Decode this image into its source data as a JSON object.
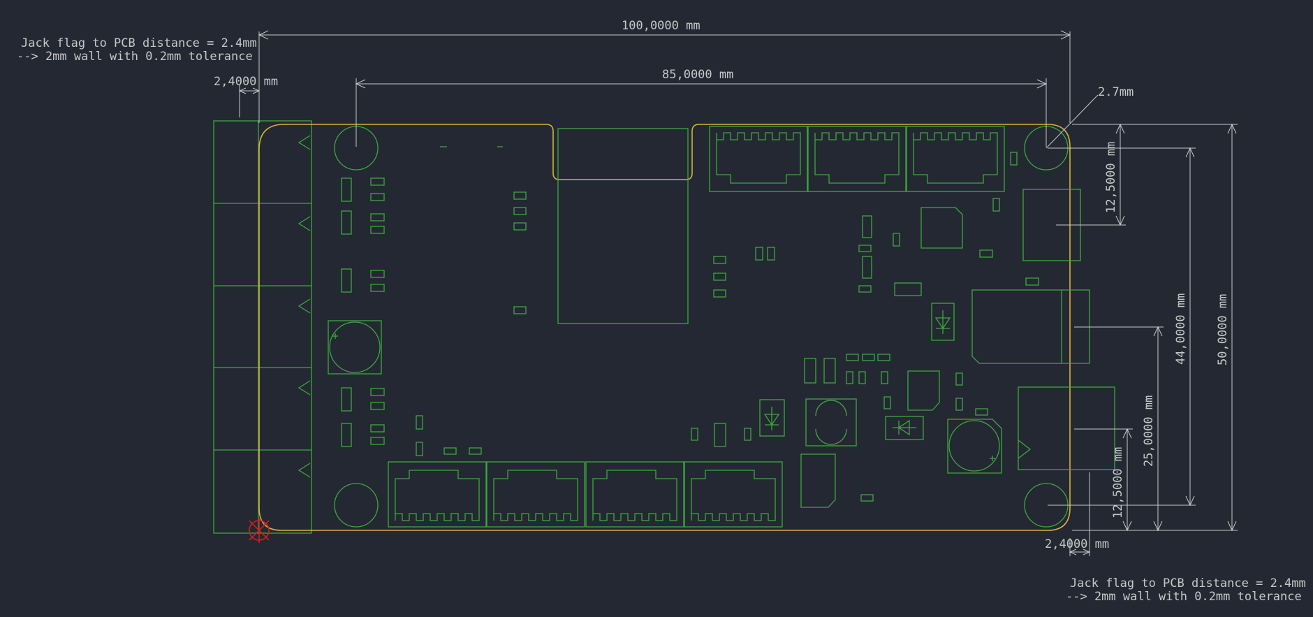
{
  "colors": {
    "background": "#232832",
    "dimension": "#c8c8c8",
    "footprint": "#3fa83f",
    "board_edge": "#d6b23a",
    "origin_marker": "#d02020"
  },
  "dimensions": {
    "width_overall": "100,0000 mm",
    "hole_spacing_x": "85,0000 mm",
    "jack_offset_left": "2,4000 mm",
    "jack_offset_right": "2,4000 mm",
    "corner_radius": "2.7mm",
    "right_12_5_top": "12,5000 mm",
    "right_44": "44,0000 mm",
    "right_50": "50,0000 mm",
    "right_25": "25,0000 mm",
    "right_12_5_bottom": "12,5000 mm"
  },
  "notes": {
    "left_line1": "Jack flag to PCB distance = 2.4mm",
    "left_line2": "--> 2mm wall with 0.2mm tolerance",
    "right_line1": "Jack flag to PCB distance = 2.4mm",
    "right_line2": "--> 2mm wall with 0.2mm tolerance"
  }
}
